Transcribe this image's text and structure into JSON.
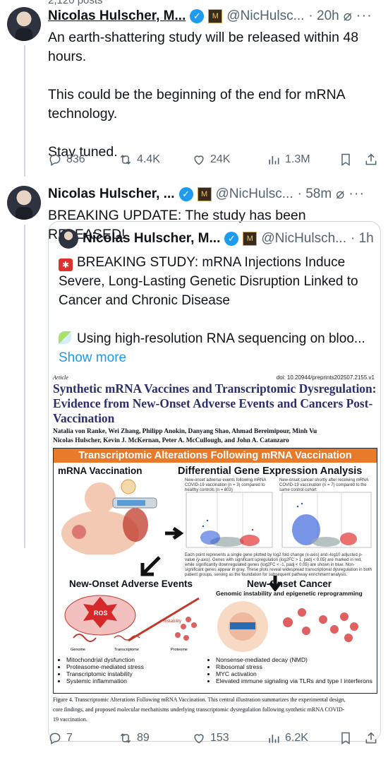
{
  "top_partial": "2,120 posts",
  "tweet1": {
    "name": "Nicolas Hulscher, M...",
    "handle": "@NicHulsc...",
    "time": "· 20h",
    "text_lines": [
      "An earth-shattering study will be released within 48",
      "hours.",
      "",
      "This could be the beginning of the end for mRNA",
      "technology.",
      "",
      "Stay tuned."
    ],
    "replies": "836",
    "reposts": "4.4K",
    "likes": "24K",
    "views": "1.3M"
  },
  "tweet2": {
    "name": "Nicolas Hulscher, ...",
    "handle": "@NicHulsc...",
    "time": "· 58m",
    "text": "BREAKING UPDATE: The study has been RELEASED!",
    "replies": "7",
    "reposts": "89",
    "likes": "153",
    "views": "6.2K"
  },
  "quote": {
    "name": "Nicolas Hulscher, M...",
    "handle": "@NicHulsch...",
    "time": "· 1h",
    "line1": "BREAKING STUDY: mRNA Injections Induce",
    "line2": "Severe, Long-Lasting Genetic Disruption Linked to",
    "line3": "Cancer and Chronic Disease",
    "line4": "Using high-resolution RNA sequencing on bloo...",
    "show_more": "Show more"
  },
  "paper": {
    "article": "Article",
    "doi": "doi: 10.20944/preprints202507.2155.v1",
    "title_lines": [
      "Synthetic mRNA Vaccines and Transcriptomic Dysregulation:",
      "Evidence from New-Onset Adverse Events and Cancers Post-",
      "Vaccination"
    ],
    "authors_line1": "Natalia von Ranke, Wei Zhang, Philipp Anokin, Danyang Shao, Ahmad Bereimipour, Minh Vu",
    "authors_line2": "Nicolas Hulscher, Kevin J. McKernan, Peter A. McCullough, and John A. Catanzaro",
    "figure": {
      "banner": "Transcriptomic Alterations Following mRNA Vaccination",
      "panel_a": "mRNA Vaccination",
      "panel_b": "Differential Gene Expression Analysis",
      "panel_b_left": "New-onset adverse events following mRNA COVID-19 vaccination (n = 3) compared to healthy controls (n = 803)",
      "panel_b_right": "New-onset cancer shortly after receiving mRNA COVID-19 vaccination (n = 7) compared to the same control cohort",
      "panel_b_caption": "Each point represents a single gene plotted by log2 fold change (x-axis) and -log10 adjusted p-value (y-axis). Genes with significant upregulation (log2FC > 1, padj < 0.05) are marked in red, while significantly downregulated genes (log2FC < -1, padj < 0.05) are shown in blue. Non-significant genes appear in gray. These plots reveal widespread transcriptional dysregulation in both patient groups, serving as the foundation for subsequent pathway enrichment analysis.",
      "panel_c": "New-Onset Adverse Events",
      "panel_c_labels": [
        "ROS",
        "Genome",
        "Transcriptome",
        "Proteome",
        "Instability"
      ],
      "panel_c_bullets": [
        "Mitochondrial dysfunction",
        "Proteasome-mediated stress",
        "Transcriptomic instability",
        "Systemic inflammation"
      ],
      "panel_d": "New-Onset Cancer",
      "panel_d_sub": "Genomic instability and epigenetic reprogramming",
      "panel_d_bullets": [
        "Nonsense-mediated decay (NMD)",
        "Ribosomal stress",
        "MYC activation",
        "Elevated immune signaling via TLRs and type I interferons"
      ]
    },
    "caption_lines": [
      "Figure 4. Transcriptomic Alterations Following mRNA Vaccination. This central illustration summarizes the experimental design,",
      "core findings, and proposed molecular mechanisms underlying transcriptomic dysregulation following synthetic mRNA COVID-",
      "19 vaccination."
    ]
  },
  "colors": {
    "accent": "#1d9bf0",
    "banner": "#e77b2a",
    "upregulated": "#e02424",
    "downregulated": "#1f4fd8"
  }
}
